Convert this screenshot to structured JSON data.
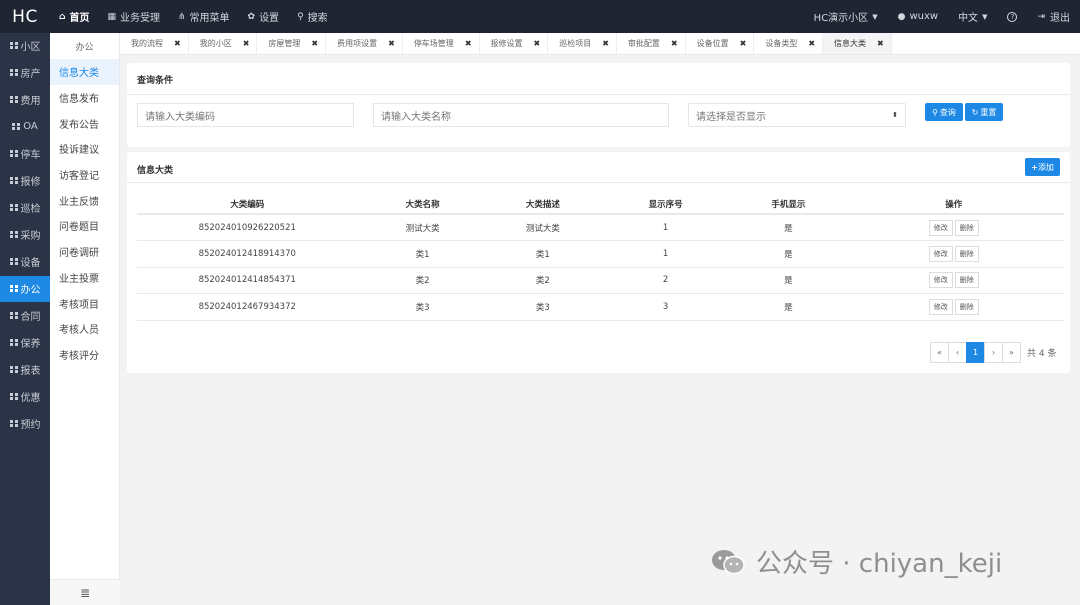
{
  "topbar": {
    "logo": "HC",
    "nav": [
      {
        "label": "首页",
        "icon": "home-icon",
        "glyph": "⌂",
        "active": true
      },
      {
        "label": "业务受理",
        "icon": "calendar-icon",
        "glyph": "▦",
        "active": false
      },
      {
        "label": "常用菜单",
        "icon": "sitemap-icon",
        "glyph": "⋔",
        "active": false
      },
      {
        "label": "设置",
        "icon": "gear-icon",
        "glyph": "✿",
        "active": false
      },
      {
        "label": "搜索",
        "icon": "search-icon",
        "glyph": "⚲",
        "active": false
      }
    ],
    "community": "HC演示小区",
    "user": "wuxw",
    "language": "中文",
    "help_glyph": "?",
    "logout": "退出"
  },
  "sidebar": {
    "items": [
      {
        "label": "小区"
      },
      {
        "label": "房产"
      },
      {
        "label": "费用"
      },
      {
        "label": "OA"
      },
      {
        "label": "停车"
      },
      {
        "label": "报修"
      },
      {
        "label": "巡检"
      },
      {
        "label": "采购"
      },
      {
        "label": "设备"
      },
      {
        "label": "办公"
      },
      {
        "label": "合同"
      },
      {
        "label": "保养"
      },
      {
        "label": "报表"
      },
      {
        "label": "优惠"
      },
      {
        "label": "预约"
      }
    ],
    "active_index": 9
  },
  "submenu": {
    "header": "办公",
    "items": [
      "信息大类",
      "信息发布",
      "发布公告",
      "投诉建议",
      "访客登记",
      "业主反馈",
      "问卷题目",
      "问卷调研",
      "业主投票",
      "考核项目",
      "考核人员",
      "考核评分"
    ],
    "active_index": 0,
    "footer_glyph": "≣"
  },
  "tabs": [
    "我的流程",
    "我的小区",
    "房屋管理",
    "费用项设置",
    "停车场管理",
    "报修设置",
    "巡检项目",
    "审批配置",
    "设备位置",
    "设备类型",
    "信息大类"
  ],
  "active_tab": 10,
  "query": {
    "title": "查询条件",
    "code_placeholder": "请输入大类编码",
    "name_placeholder": "请输入大类名称",
    "show_placeholder": "请选择是否显示",
    "search_label": "查询",
    "reset_label": "重置"
  },
  "list": {
    "title": "信息大类",
    "add_label": "添加",
    "columns": [
      "大类编码",
      "大类名称",
      "大类描述",
      "显示序号",
      "手机显示",
      "操作"
    ],
    "rows": [
      [
        "852024010926220521",
        "测试大类",
        "测试大类",
        "1",
        "是"
      ],
      [
        "852024012418914370",
        "类1",
        "类1",
        "1",
        "是"
      ],
      [
        "852024012414854371",
        "类2",
        "类2",
        "2",
        "是"
      ],
      [
        "852024012467934372",
        "类3",
        "类3",
        "3",
        "是"
      ]
    ],
    "edit_label": "修改",
    "delete_label": "删除",
    "pager": {
      "first": "«",
      "prev": "‹",
      "current": "1",
      "next": "›",
      "last": "»",
      "total": "共 4 条"
    }
  },
  "watermark": "公众号 · chiyan_keji",
  "colors": {
    "accent": "#1e88e5",
    "topbar": "#1f2533",
    "sidebar": "#2b3446"
  }
}
